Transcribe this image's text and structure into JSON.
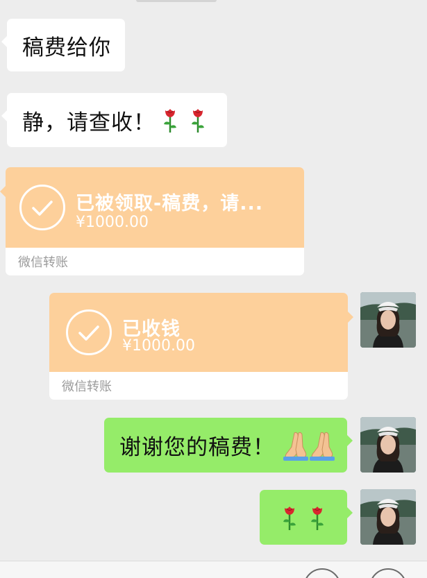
{
  "messages": {
    "m1": {
      "text": "稿费给你"
    },
    "m2": {
      "text": "静，请查收！"
    },
    "transfer_sent": {
      "title": "已被领取-稿费，请...",
      "amount": "¥1000.00",
      "footer": "微信转账"
    },
    "transfer_received": {
      "title": "已收钱",
      "amount": "¥1000.00",
      "footer": "微信转账"
    },
    "m3": {
      "text": "谢谢您的稿费！"
    }
  },
  "icons": {
    "rose": "rose-emoji",
    "pray": "folded-hands-emoji",
    "check": "check-circle-icon"
  },
  "colors": {
    "background": "#ededed",
    "bubble_white": "#ffffff",
    "bubble_green": "#95ec69",
    "transfer_orange": "#fdd09b"
  }
}
